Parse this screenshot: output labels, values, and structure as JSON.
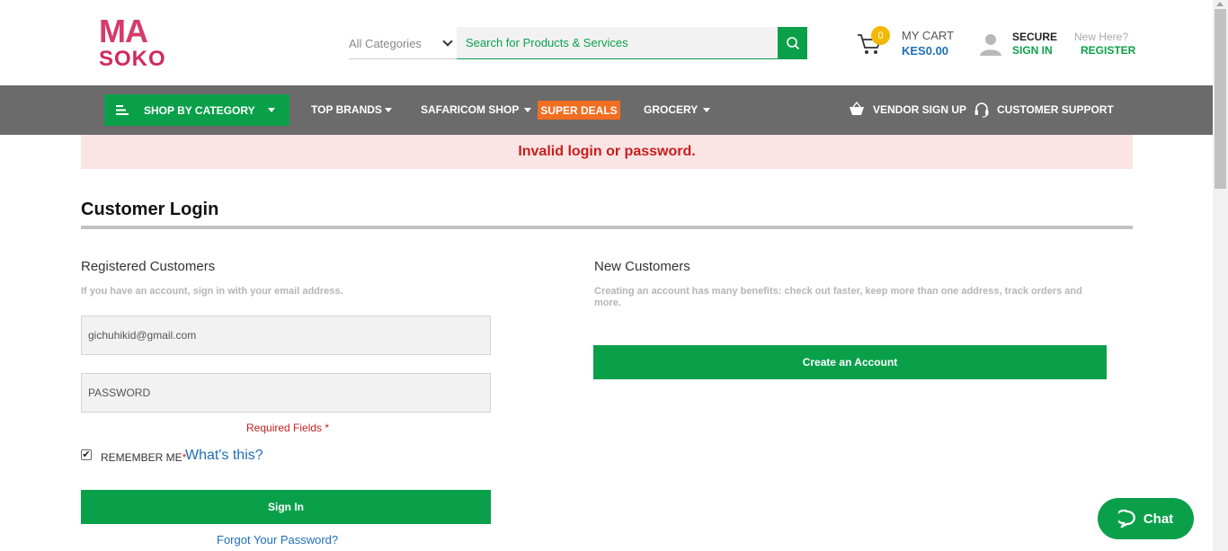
{
  "brand": {
    "logo_top": "MA",
    "logo_bottom": "SOKO"
  },
  "search": {
    "category": "All Categories",
    "placeholder": "Search for Products & Services"
  },
  "cart": {
    "count": "0",
    "label": "MY CART",
    "total": "KES0.00"
  },
  "account": {
    "secure_label": "SECURE",
    "signin_label": "SIGN IN",
    "newhere_label": "New Here?",
    "register_label": "REGISTER"
  },
  "nav": {
    "shop_by_category": "SHOP BY CATEGORY",
    "top_brands": "TOP BRANDS",
    "safaricom_shop": "SAFARICOM SHOP",
    "super_deals": "SUPER DEALS",
    "grocery": "GROCERY",
    "vendor_signup": "VENDOR SIGN UP",
    "customer_support": "CUSTOMER SUPPORT"
  },
  "alert": {
    "message": "Invalid login or password."
  },
  "page": {
    "title": "Customer Login"
  },
  "registered": {
    "heading": "Registered Customers",
    "note": "If you have an account, sign in with your email address.",
    "email_value": "gichuhikid@gmail.com",
    "password_placeholder": "PASSWORD",
    "required_text": "Required Fields *",
    "remember_label": "REMEMBER ME",
    "remember_star": "*",
    "whats_this": "What's this?",
    "signin_button": "Sign In",
    "forgot_link": "Forgot Your Password?"
  },
  "new_customers": {
    "heading": "New Customers",
    "note": "Creating an account has many benefits: check out faster, keep more than one address, track orders and more.",
    "create_button": "Create an Account"
  },
  "chat": {
    "label": "Chat"
  },
  "colors": {
    "brand_green": "#0aa04a",
    "nav_gray": "#6b6b6b",
    "alert_bg": "#fae5e4",
    "alert_text": "#c81e1e",
    "deal_orange": "#f26e21",
    "logo_pink": "#d63b6a",
    "link_blue": "#1e6fb8"
  },
  "icons": {
    "search": "search-icon",
    "cart": "cart-icon",
    "user": "user-icon",
    "menu": "menu-bars-icon",
    "vendor": "basket-icon",
    "support": "headset-icon",
    "chat": "chat-bubble-icon",
    "checkbox": "check-icon"
  },
  "state": {
    "remember_me_checked": true
  }
}
